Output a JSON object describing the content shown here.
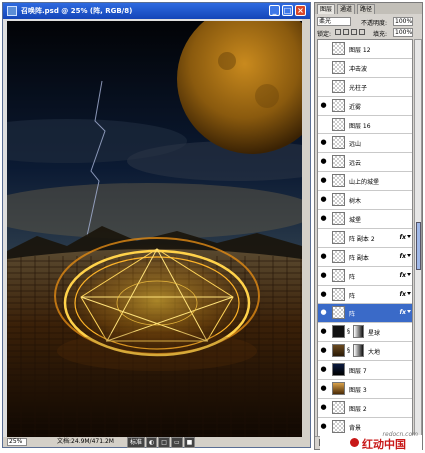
{
  "document": {
    "title": "召唤阵.psd @ 25% (阵, RGB/8)",
    "zoom": "25%",
    "doc_size": "文档:24.9M/471.2M",
    "toolbar_label": "标准"
  },
  "layers_panel": {
    "tabs": [
      "图层",
      "通道",
      "路径"
    ],
    "blend_mode": "柔光",
    "opacity_label": "不透明度:",
    "opacity": "100%",
    "lock_label": "锁定:",
    "fill_label": "填充:",
    "fill": "100%",
    "layers": [
      {
        "name": "图层 12",
        "visible": false,
        "thumb": "checker"
      },
      {
        "name": "冲击波",
        "visible": false,
        "thumb": "checker"
      },
      {
        "name": "光柱子",
        "visible": false,
        "thumb": "checker"
      },
      {
        "name": "近雾",
        "visible": true,
        "thumb": "checker"
      },
      {
        "name": "图层 16",
        "visible": false,
        "thumb": "checker"
      },
      {
        "name": "远山",
        "visible": true,
        "thumb": "checker"
      },
      {
        "name": "远云",
        "visible": true,
        "thumb": "checker"
      },
      {
        "name": "山上的城堡",
        "visible": true,
        "thumb": "checker"
      },
      {
        "name": "树木",
        "visible": true,
        "thumb": "checker"
      },
      {
        "name": "城堡",
        "visible": true,
        "thumb": "checker"
      },
      {
        "name": "阵 副本 2",
        "visible": false,
        "thumb": "checker",
        "fx": "fx"
      },
      {
        "name": "阵 副本",
        "visible": true,
        "thumb": "checker",
        "fx": "fx"
      },
      {
        "name": "阵",
        "visible": true,
        "thumb": "checker",
        "fx": "fx"
      },
      {
        "name": "阵",
        "visible": true,
        "thumb": "checker",
        "fx": "fx"
      },
      {
        "name": "阵",
        "visible": true,
        "thumb": "checker",
        "fx": "fx",
        "selected": true
      },
      {
        "name": "星球",
        "visible": true,
        "thumb": "dark",
        "mask": true
      },
      {
        "name": "大地",
        "visible": true,
        "thumb": "earth",
        "mask": true
      },
      {
        "name": "图层 7",
        "visible": true,
        "thumb": "night"
      },
      {
        "name": "图层 3",
        "visible": true,
        "thumb": "gold"
      },
      {
        "name": "图层 2",
        "visible": true,
        "thumb": "checker"
      },
      {
        "name": "背景",
        "visible": true,
        "thumb": "checker"
      }
    ]
  },
  "watermark": {
    "url": "redocn.com",
    "text": "红动中国"
  },
  "colors": {
    "titlebar": "#1c55c8",
    "selection": "#3a6ac8",
    "watermark": "#c81818"
  }
}
